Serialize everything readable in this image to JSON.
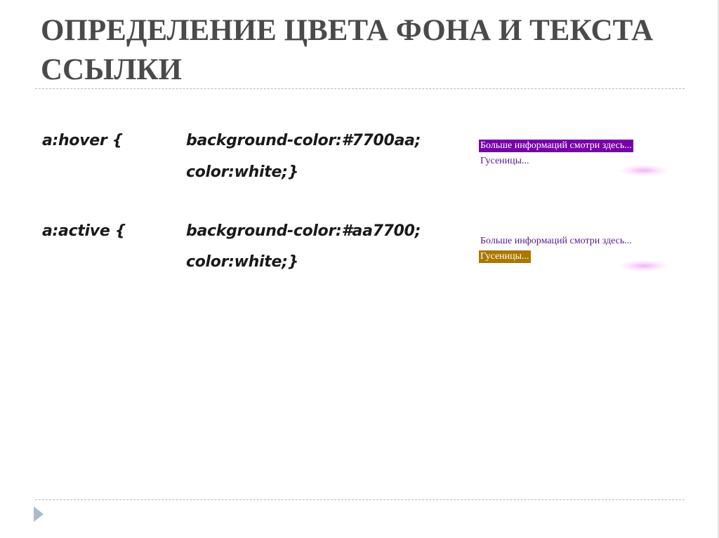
{
  "slide": {
    "title_line1": "ОПРЕДЕЛЕНИЕ ЦВЕТА ФОНА И ТЕКСТА",
    "title_line2": "ССЫЛКИ"
  },
  "rules": [
    {
      "selector": "a:hover {",
      "line1": "background-color:#7700aa;",
      "line2": "color:white;}"
    },
    {
      "selector": "a:active {",
      "line1": "background-color:#aa7700;",
      "line2": "color:white;}"
    }
  ],
  "demos": [
    {
      "link1": "Больше информаций смотри здесь...",
      "link2": "Гусеницы...",
      "highlighted": "link1",
      "highlight_color": "#7700aa"
    },
    {
      "link1": "Больше информаций смотри здесь...",
      "link2": "Гусеницы...",
      "highlighted": "link2",
      "highlight_color": "#aa7700"
    }
  ],
  "colors": {
    "title": "#4a4a4a",
    "rule": "#a9bccd",
    "visited_link": "#551a8b"
  },
  "icons": {
    "nav": "triangle-right-icon"
  }
}
